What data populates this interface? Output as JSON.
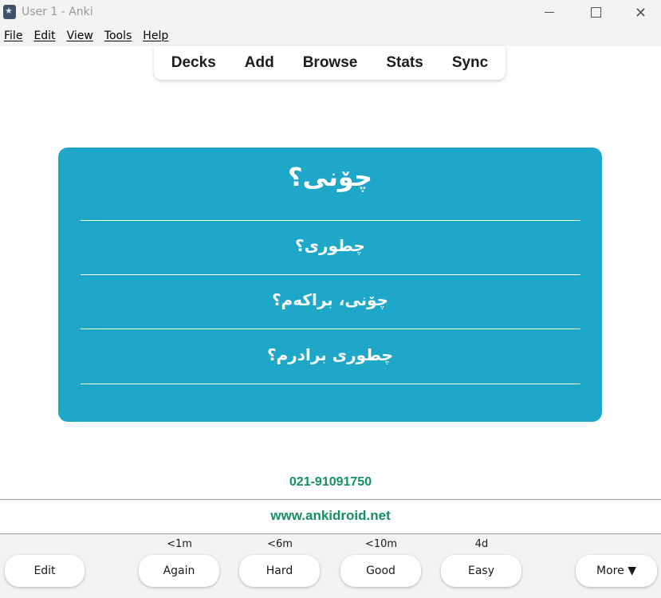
{
  "window": {
    "title": "User 1 - Anki",
    "icons": {
      "app": "anki-star-icon",
      "minimize": "minimize-icon",
      "maximize": "maximize-icon",
      "close": "close-icon"
    },
    "close_glyph": "✕"
  },
  "menu": {
    "items": [
      "File",
      "Edit",
      "View",
      "Tools",
      "Help"
    ]
  },
  "toolbar": {
    "items": [
      "Decks",
      "Add",
      "Browse",
      "Stats",
      "Sync"
    ]
  },
  "card": {
    "background": "#1ea7c9",
    "title": "چۆنی؟",
    "lines": [
      "چطوری؟",
      "چۆنی، براکەم؟",
      "چطوری برادرم؟"
    ]
  },
  "footer": {
    "phone": "021-91091750",
    "website": "www.ankidroid.net",
    "accent": "#14915e"
  },
  "answer_bar": {
    "edit_label": "Edit",
    "more_label": "More ▼",
    "buttons": [
      {
        "interval": "<1m",
        "label": "Again"
      },
      {
        "interval": "<6m",
        "label": "Hard"
      },
      {
        "interval": "<10m",
        "label": "Good"
      },
      {
        "interval": "4d",
        "label": "Easy"
      }
    ]
  }
}
